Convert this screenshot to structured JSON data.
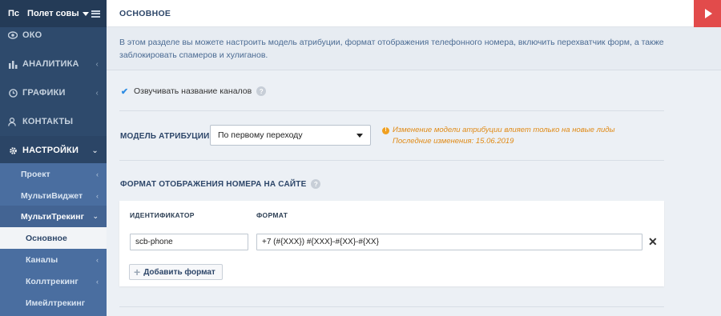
{
  "sidebar": {
    "avatar": "Пс",
    "project": "Полет совы",
    "items": [
      {
        "label": "ОКО",
        "icon": "eye-icon"
      },
      {
        "label": "АНАЛИТИКА",
        "icon": "bar-chart-icon"
      },
      {
        "label": "ГРАФИКИ",
        "icon": "clock-icon"
      },
      {
        "label": "КОНТАКТЫ",
        "icon": "users-icon"
      },
      {
        "label": "НАСТРОЙКИ",
        "icon": "gear-icon"
      }
    ],
    "sub": [
      {
        "label": "Проект"
      },
      {
        "label": "МультиВиджет"
      },
      {
        "label": "МультиТрекинг"
      }
    ],
    "subsub": [
      {
        "label": "Основное"
      },
      {
        "label": "Каналы"
      },
      {
        "label": "Коллтрекинг"
      },
      {
        "label": "Имейлтрекинг"
      }
    ]
  },
  "header": {
    "title": "ОСНОВНОЕ"
  },
  "description": "В этом разделе вы можете настроить модель атрибуции, формат отображения телефонного номера, включить перехватчик форм, а также заблокировать спамеров и хулиганов.",
  "checkbox": {
    "label": "Озвучивать название каналов",
    "checked": true
  },
  "attribution": {
    "label": "МОДЕЛЬ АТРИБУЦИИ:",
    "value": "По первому переходу",
    "warning": "Изменение модели атрибуции влияет только на новые лиды",
    "last_change": "Последние изменения: 15.06.2019"
  },
  "format_section": {
    "title": "ФОРМАТ ОТОБРАЖЕНИЯ НОМЕРА НА САЙТЕ",
    "col_identifier": "ИДЕНТИФИКАТОР",
    "col_format": "ФОРМАТ",
    "rows": [
      {
        "identifier": "scb-phone",
        "format": "+7 (#{XXX}) #{XXX}-#{XX}-#{XX}"
      }
    ],
    "add_label": "Добавить формат"
  },
  "help_glyph": "?",
  "colors": {
    "sidebar": "#2e4a6c",
    "submenu": "#4a6ea0",
    "accent_red": "#e24b4b",
    "warning": "#e08a16"
  }
}
